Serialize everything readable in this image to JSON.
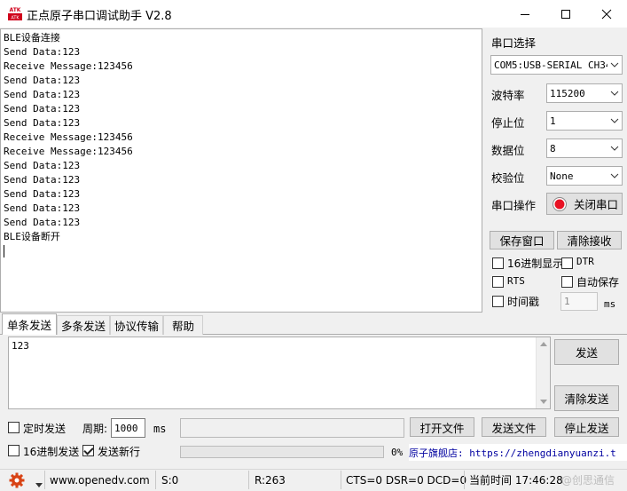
{
  "window": {
    "title": "正点原子串口调试助手 V2.8",
    "logo_text": "ATK"
  },
  "receive": {
    "lines": [
      "BLE设备连接",
      "Send Data:123",
      "Receive Message:123456",
      "Send Data:123",
      "Send Data:123",
      "Send Data:123",
      "Send Data:123",
      "Receive Message:123456",
      "Receive Message:123456",
      "Send Data:123",
      "Send Data:123",
      "Send Data:123",
      "Send Data:123",
      "Send Data:123",
      "BLE设备断开"
    ]
  },
  "settings": {
    "port_select_label": "串口选择",
    "port_value": "COM5:USB-SERIAL CH340",
    "baud_label": "波特率",
    "baud_value": "115200",
    "stopbits_label": "停止位",
    "stopbits_value": "1",
    "databits_label": "数据位",
    "databits_value": "8",
    "parity_label": "校验位",
    "parity_value": "None",
    "port_op_label": "串口操作",
    "close_port_button": "关闭串口",
    "save_window_button": "保存窗口",
    "clear_receive_button": "清除接收",
    "hex_display_label": "16进制显示",
    "dtr_label": "DTR",
    "rts_label": "RTS",
    "auto_save_label": "自动保存",
    "timestamp_label": "时间戳",
    "timestamp_value": "1",
    "timestamp_unit": "ms",
    "accent_color": "#e81123"
  },
  "tabs": [
    "单条发送",
    "多条发送",
    "协议传输",
    "帮助"
  ],
  "send": {
    "text": "123",
    "send_button": "发送",
    "clear_send_button": "清除发送",
    "timed_send_label": "定时发送",
    "period_label": "周期:",
    "period_value": "1000",
    "period_unit": "ms",
    "open_file_button": "打开文件",
    "send_file_button": "发送文件",
    "stop_send_button": "停止发送",
    "hex_send_label": "16进制发送",
    "send_newline_label": "发送新行",
    "send_newline_checked": true,
    "progress_text": "0%",
    "progress": 0,
    "promo_text": "原子旗舰店: https://zhengdianyuanzi.t"
  },
  "status": {
    "website": "www.openedv.com",
    "sent": "S:0",
    "received": "R:263",
    "lines": "CTS=0 DSR=0 DCD=0",
    "time": "当前时间 17:46:28",
    "watermark": "@创思通信"
  }
}
